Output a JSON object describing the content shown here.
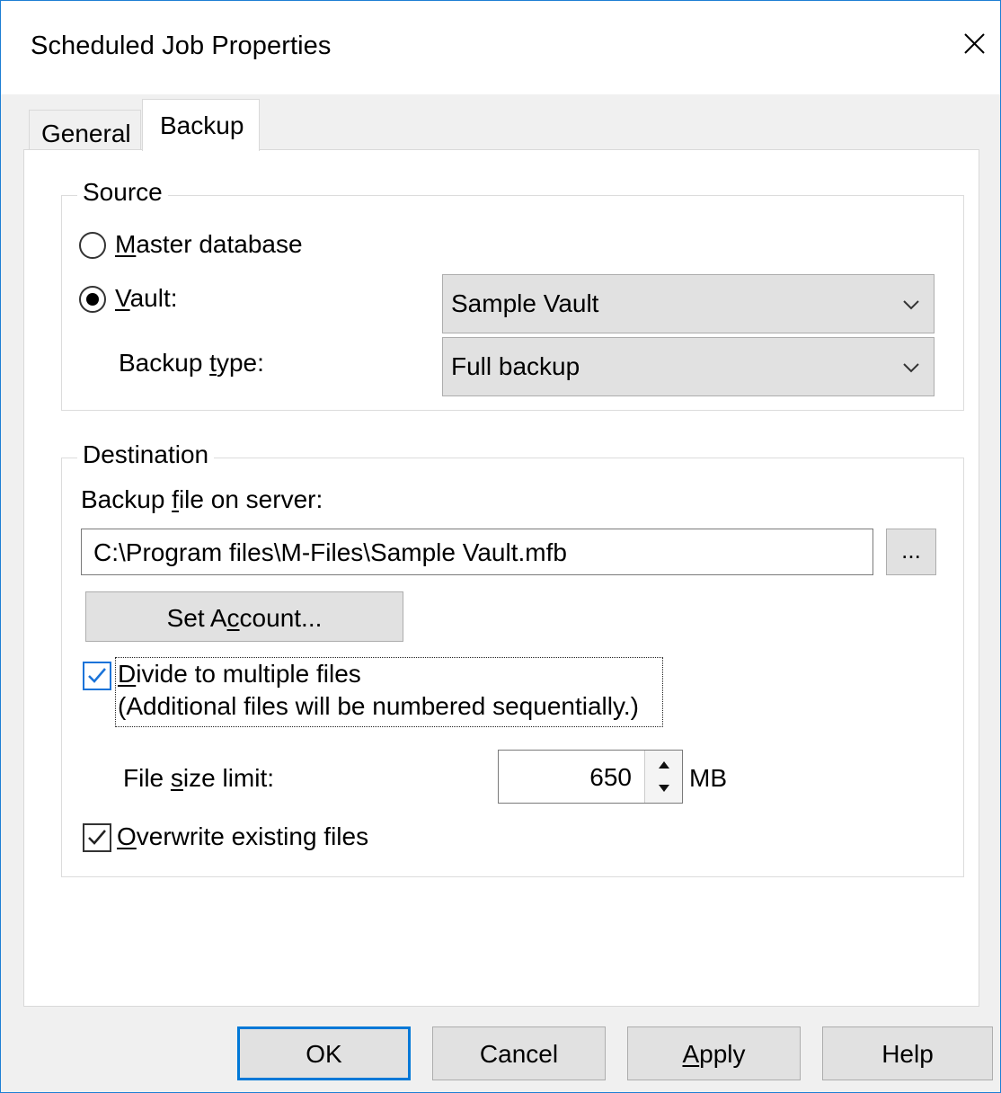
{
  "window": {
    "title": "Scheduled Job Properties",
    "close_icon": "close-icon",
    "accent_color": "#0078d7"
  },
  "tabs": [
    {
      "label": "General",
      "selected": false
    },
    {
      "label": "Backup",
      "selected": true
    }
  ],
  "source": {
    "legend": "Source",
    "master_database": {
      "prefix": "M",
      "rest": "aster database",
      "checked": false
    },
    "vault": {
      "prefix": "V",
      "rest": "ault:",
      "checked": true
    },
    "vault_select": {
      "value": "Sample Vault",
      "icon": "chevron-down-icon"
    },
    "backup_type_label": {
      "before": "Backup ",
      "underline": "t",
      "after": "ype:"
    },
    "backup_type_select": {
      "value": "Full backup",
      "icon": "chevron-down-icon"
    }
  },
  "destination": {
    "legend": "Destination",
    "file_label": {
      "before": "Backup ",
      "underline": "f",
      "after": "ile on server:"
    },
    "file_path": "C:\\Program files\\M-Files\\Sample Vault.mfb",
    "browse_label": "...",
    "set_account": {
      "before": "Set A",
      "underline": "c",
      "after": "count..."
    },
    "divide": {
      "underline": "D",
      "rest": "ivide to multiple files",
      "note": "(Additional files will be numbered sequentially.)",
      "checked": true
    },
    "size_limit_label": {
      "before": "File ",
      "underline": "s",
      "after": "ize limit:"
    },
    "size_limit_value": "650",
    "size_unit": "MB",
    "overwrite": {
      "underline": "O",
      "rest": "verwrite existing files",
      "checked": true
    }
  },
  "footer": {
    "ok": "OK",
    "cancel": "Cancel",
    "apply": {
      "underline": "A",
      "rest": "pply"
    },
    "help": "Help"
  }
}
